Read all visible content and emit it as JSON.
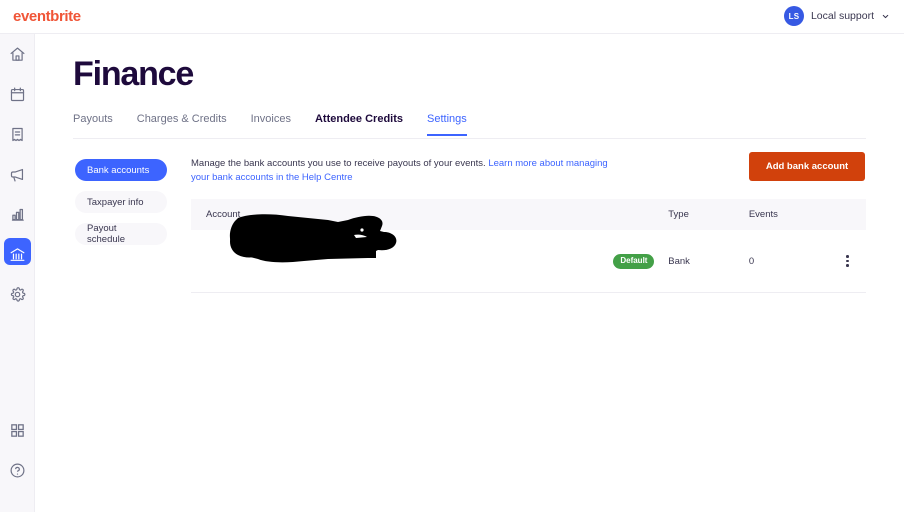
{
  "topbar": {
    "logo_text": "eventbrite",
    "logo_color": "#f05537",
    "account": {
      "avatar_initials": "LS",
      "avatar_color": "#3659e3",
      "name": "Local support",
      "chevron_icon": "chevron-down-icon"
    }
  },
  "rail": {
    "items": [
      {
        "icon": "home-icon",
        "active": false
      },
      {
        "icon": "calendar-icon",
        "active": false
      },
      {
        "icon": "order-icon",
        "active": false
      },
      {
        "icon": "megaphone-icon",
        "active": false
      },
      {
        "icon": "bar-chart-icon",
        "active": false
      },
      {
        "icon": "bank-icon",
        "active": true
      },
      {
        "icon": "gear-icon",
        "active": false
      }
    ],
    "bottom_items": [
      {
        "icon": "apps-grid-icon",
        "active": false
      },
      {
        "icon": "help-icon",
        "active": false
      }
    ],
    "active_color": "#3d64ff"
  },
  "page": {
    "title": "Finance",
    "tabs": [
      {
        "label": "Payouts",
        "state": "default"
      },
      {
        "label": "Charges & Credits",
        "state": "default"
      },
      {
        "label": "Invoices",
        "state": "default"
      },
      {
        "label": "Attendee Credits",
        "state": "bold"
      },
      {
        "label": "Settings",
        "state": "active"
      }
    ]
  },
  "subnav": {
    "items": [
      {
        "label": "Bank accounts",
        "active": true
      },
      {
        "label": "Taxpayer info",
        "active": false
      },
      {
        "label": "Payout schedule",
        "active": false
      }
    ]
  },
  "description": {
    "text": "Manage the bank accounts you use to receive payouts of your events. ",
    "link_text": "Learn more about managing your bank accounts in the Help Centre",
    "link_color": "#3d64ff"
  },
  "actions": {
    "add_bank_account_label": "Add bank account",
    "add_bank_account_color": "#d1410c"
  },
  "table": {
    "headers": {
      "account": "Account",
      "type": "Type",
      "events": "Events"
    },
    "rows": [
      {
        "account": "",
        "account_redacted": true,
        "badge": "Default",
        "badge_color": "#43a047",
        "type": "Bank",
        "events": "0",
        "menu_icon": "kebab-menu-icon"
      }
    ]
  }
}
